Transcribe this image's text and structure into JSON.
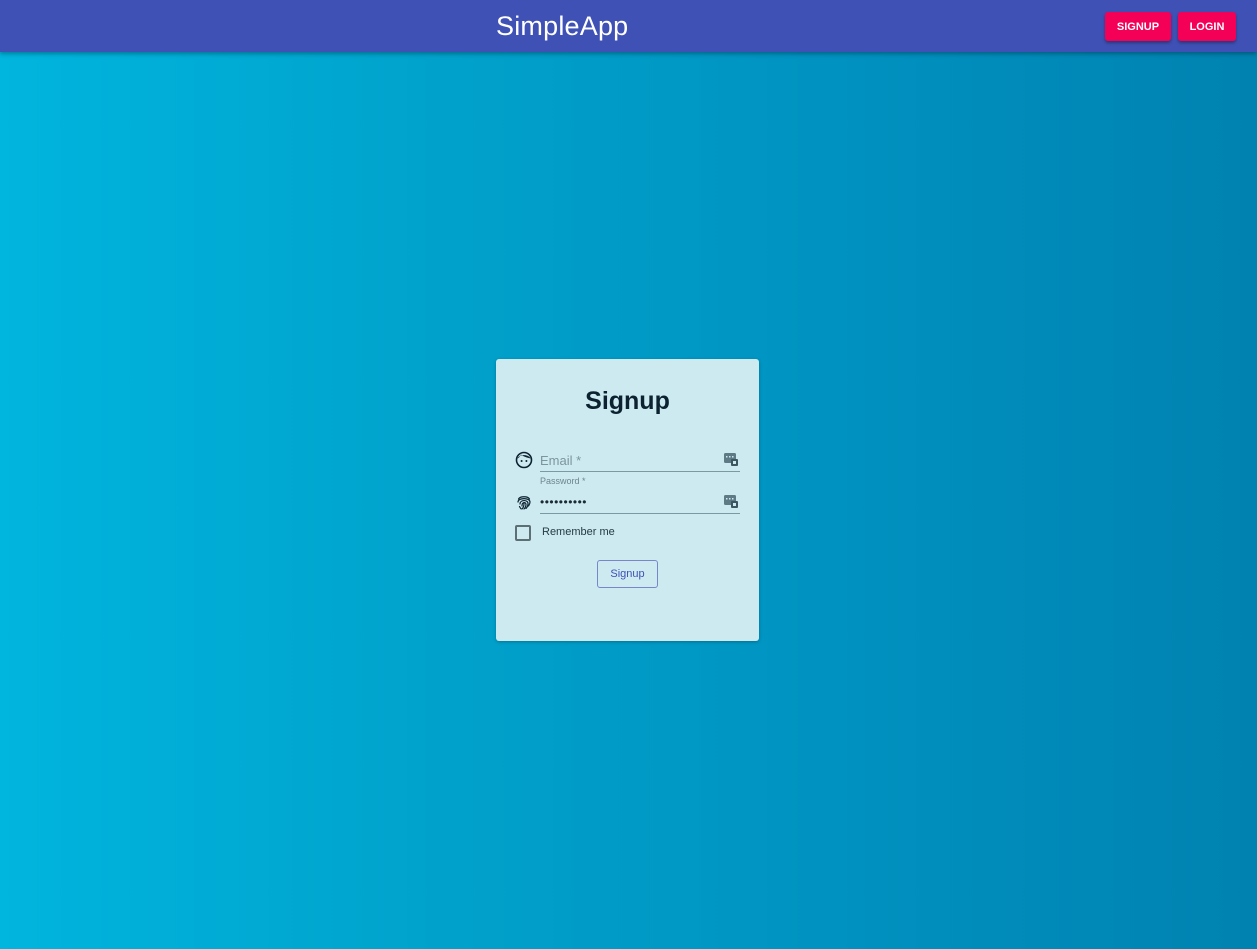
{
  "appbar": {
    "title": "SimpleApp",
    "signup_label": "SIGNUP",
    "login_label": "LOGIN"
  },
  "form": {
    "title": "Signup",
    "email": {
      "placeholder": "Email *",
      "value": "",
      "icon": "face-icon"
    },
    "password": {
      "label": "Password *",
      "value": "••••••••••",
      "icon": "fingerprint-icon"
    },
    "remember_label": "Remember me",
    "remember_checked": false,
    "submit_label": "Signup"
  },
  "colors": {
    "appbar": "#3f51b5",
    "accent_button": "#f50057",
    "background_start": "#00b5de",
    "background_end": "#0082b0",
    "card": "#cdeaf1",
    "primary_text": "#3f51b5"
  }
}
